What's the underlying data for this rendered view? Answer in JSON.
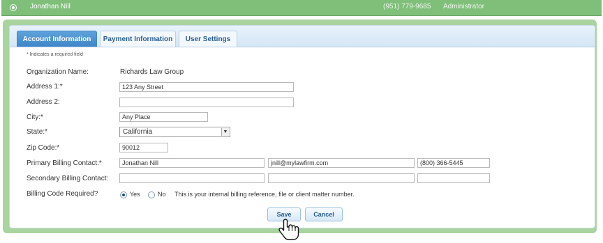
{
  "header": {
    "user_name": "Jonathan Nill",
    "phone": "(951) 779-9685",
    "role": "Administrator"
  },
  "tabs": [
    {
      "label": "Account Information",
      "active": true
    },
    {
      "label": "Payment Information",
      "active": false
    },
    {
      "label": "User Settings",
      "active": false
    }
  ],
  "form": {
    "required_note": "* Indicates a required field",
    "org_label": "Organization Name:",
    "org_value": "Richards Law Group",
    "address1_label": "Address 1:*",
    "address1_value": "123 Any Street",
    "address2_label": "Address 2:",
    "address2_value": "",
    "city_label": "City:*",
    "city_value": "Any Place",
    "state_label": "State:*",
    "state_value": "California",
    "zip_label": "Zip Code:*",
    "zip_value": "90012",
    "primary_label": "Primary Billing Contact:*",
    "primary_name": "Jonathan Nill",
    "primary_email": "jnill@mylawfirm.com",
    "primary_phone": "(800) 366-5445",
    "secondary_label": "Secondary Billing Contact:",
    "secondary_name": "",
    "secondary_email": "",
    "secondary_phone": "",
    "billing_code_label": "Billing Code Required?",
    "yes_label": "Yes",
    "no_label": "No",
    "billing_code_selected": "Yes",
    "billing_help": "This is your internal billing reference, file or client matter number."
  },
  "actions": {
    "save_label": "Save",
    "cancel_label": "Cancel"
  }
}
